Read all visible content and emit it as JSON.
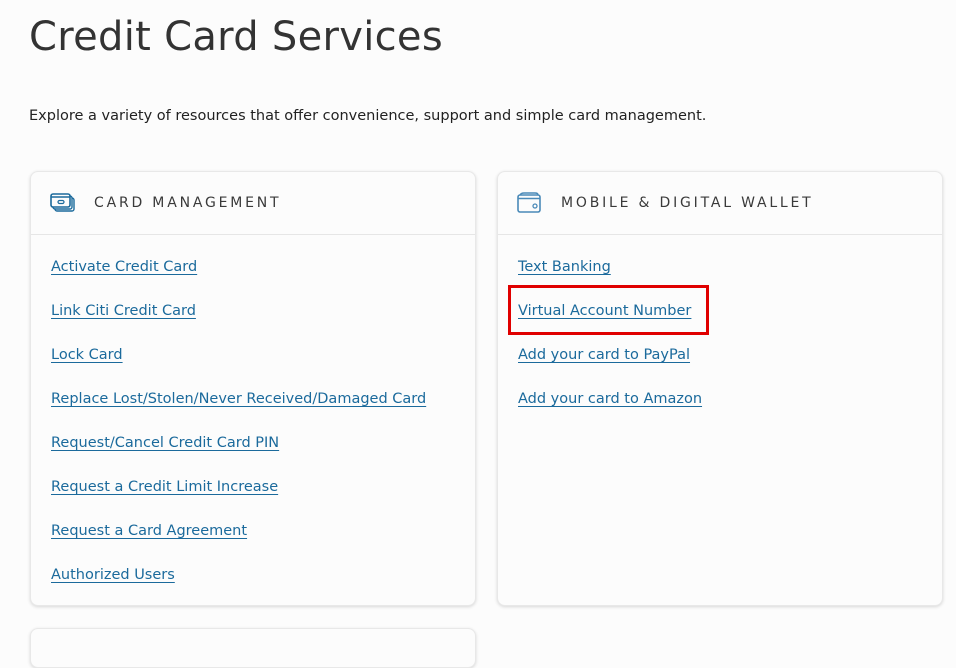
{
  "page": {
    "title": "Credit Card Services",
    "subtitle": "Explore a variety of resources that offer convenience, support and simple card management."
  },
  "sections": [
    {
      "heading": "CARD MANAGEMENT",
      "icon": "credit-cards-icon",
      "links": [
        "Activate Credit Card",
        "Link Citi Credit Card",
        "Lock Card",
        "Replace Lost/Stolen/Never Received/Damaged Card",
        "Request/Cancel Credit Card PIN",
        "Request a Credit Limit Increase",
        "Request a Card Agreement",
        "Authorized Users"
      ]
    },
    {
      "heading": "MOBILE & DIGITAL WALLET",
      "icon": "wallet-icon",
      "links": [
        "Text Banking",
        "Virtual Account Number",
        "Add your card to PayPal",
        "Add your card to Amazon"
      ],
      "highlighted_link": "Virtual Account Number"
    }
  ],
  "colors": {
    "link": "#1b6a9c",
    "icon": "#1b6a9c",
    "highlight": "#e00000"
  }
}
